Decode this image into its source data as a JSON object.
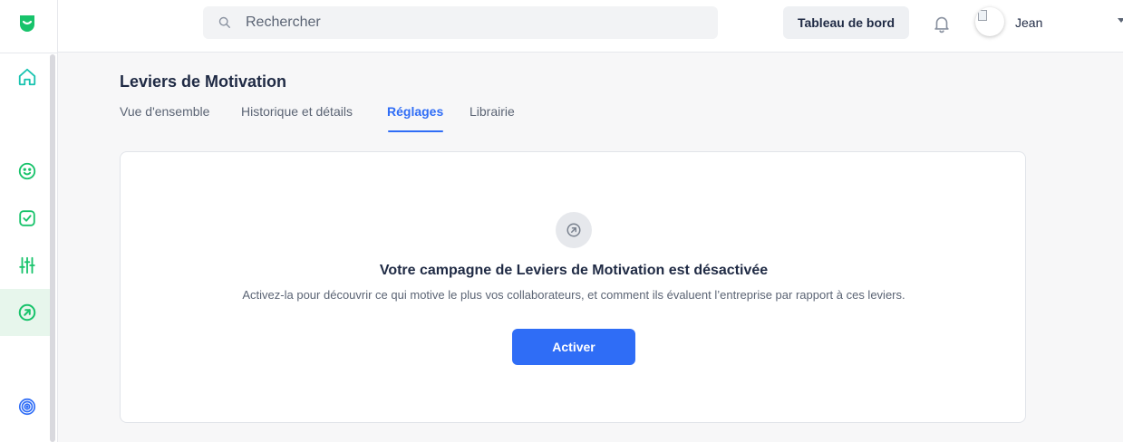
{
  "colors": {
    "brand_green": "#18c36b",
    "accent_blue": "#2f6df6",
    "sidebar_active_bg": "#e7f6ec",
    "text_primary": "#1f2a44",
    "text_secondary": "#5b6474"
  },
  "sidebar": {
    "items": [
      {
        "name": "home",
        "icon": "home-icon"
      },
      {
        "name": "mood",
        "icon": "smiley-icon"
      },
      {
        "name": "tasks",
        "icon": "checkbox-icon"
      },
      {
        "name": "settings",
        "icon": "sliders-icon"
      },
      {
        "name": "motivation",
        "icon": "arrow-circle-icon",
        "active": true
      },
      {
        "name": "target",
        "icon": "target-icon"
      }
    ]
  },
  "header": {
    "search_placeholder": "Rechercher",
    "dashboard_label": "Tableau de bord",
    "user_name": "Jean"
  },
  "page": {
    "title": "Leviers de Motivation",
    "tabs": [
      {
        "label": "Vue d'ensemble"
      },
      {
        "label": "Historique et détails"
      },
      {
        "label": "Réglages",
        "active": true
      },
      {
        "label": "Librairie"
      }
    ]
  },
  "card": {
    "icon": "arrow-circle-icon",
    "heading": "Votre campagne de Leviers de Motivation est désactivée",
    "description": "Activez-la pour découvrir ce qui motive le plus vos collaborateurs, et comment ils évaluent l’entreprise par rapport à ces leviers.",
    "button_label": "Activer"
  }
}
